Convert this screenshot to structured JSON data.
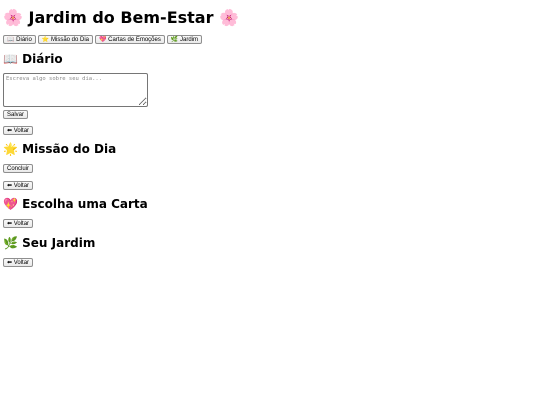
{
  "header": {
    "icon_left": "🌸",
    "title": "Jardim do Bem-Estar",
    "icon_right": "🌸"
  },
  "nav": {
    "items": [
      {
        "icon": "📖",
        "label": "Diário"
      },
      {
        "icon": "⭐",
        "label": "Missão do Dia"
      },
      {
        "icon": "💖",
        "label": "Cartas de Emoções"
      },
      {
        "icon": "🌿",
        "label": "Jardim"
      }
    ]
  },
  "diary": {
    "icon": "📖",
    "title": "Diário",
    "placeholder": "Escreva algo sobre seu dia...",
    "save_label": "Salvar",
    "back_label": "⬅ Voltar"
  },
  "mission": {
    "icon": "🌟",
    "title": "Missão do Dia",
    "complete_label": "Concluir",
    "back_label": "⬅ Voltar"
  },
  "cards": {
    "icon": "💖",
    "title": "Escolha uma Carta",
    "back_label": "⬅ Voltar"
  },
  "garden": {
    "icon": "🌿",
    "title": "Seu Jardim",
    "back_label": "⬅ Voltar"
  }
}
